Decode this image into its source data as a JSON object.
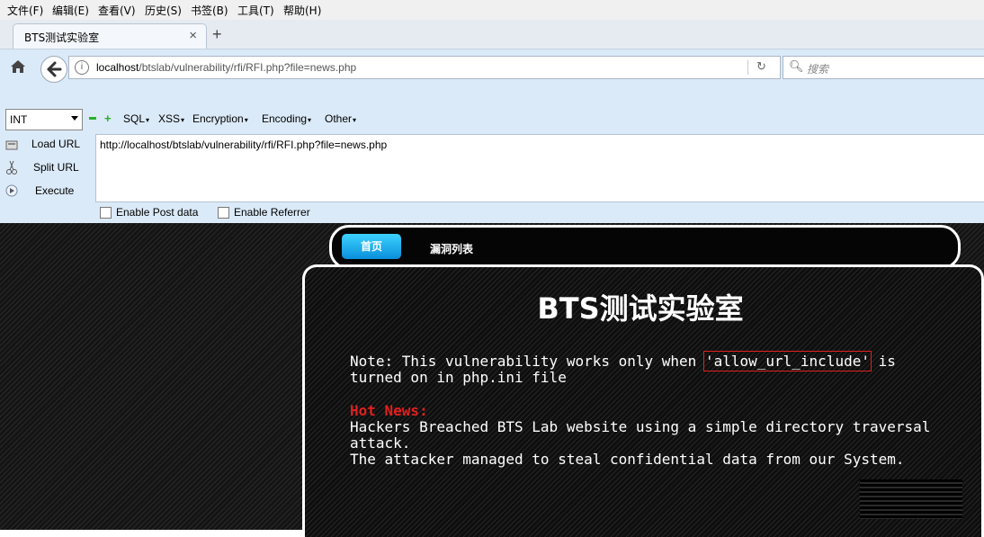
{
  "menubar": {
    "items": [
      "文件(F)",
      "编辑(E)",
      "查看(V)",
      "历史(S)",
      "书签(B)",
      "工具(T)",
      "帮助(H)"
    ]
  },
  "tab": {
    "title": "BTS测试实验室",
    "close": "×",
    "new_tab": "+"
  },
  "address_bar": {
    "host": "localhost",
    "path": "/btslab/vulnerability/rfi/RFI.php?file=news.php",
    "search_placeholder": "搜索"
  },
  "hackbar": {
    "select_value": "INT",
    "menus": [
      "SQL",
      "XSS",
      "Encryption",
      "Encoding",
      "Other"
    ],
    "load_url": "Load URL",
    "split_url": "Split URL",
    "execute": "Execute",
    "url_value": "http://localhost/btslab/vulnerability/rfi/RFI.php?file=news.php",
    "enable_post": "Enable Post data",
    "enable_referrer": "Enable Referrer"
  },
  "site": {
    "nav_home": "首页",
    "nav_vulns": "漏洞列表",
    "title": "BTS测试实验室",
    "note_pre": "Note: This vulnerability works only when ",
    "note_highlight": "'allow_url_include'",
    "note_post": " is turned on in php.ini file",
    "hot_label": "Hot News:",
    "news_line1": "Hackers Breached BTS Lab website using a simple directory traversal attack.",
    "news_line2": "The attacker managed to steal confidential data from our System."
  }
}
